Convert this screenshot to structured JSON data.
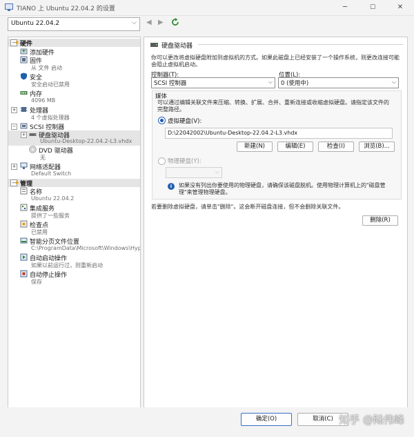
{
  "window": {
    "title": "TIANO 上 Ubuntu 22.04.2 的设置",
    "minimize": "─",
    "maximize": "☐",
    "close": "✕"
  },
  "toolbar": {
    "vm_selected": "Ubuntu 22.04.2",
    "back_icon": "◀",
    "forward_icon": "▶"
  },
  "sections": {
    "hardware": "硬件",
    "management": "管理"
  },
  "hardware_items": {
    "add_hardware": "添加硬件",
    "firmware": "固件",
    "firmware_sub": "从 文件 启动",
    "security": "安全",
    "security_sub": "安全启动已禁用",
    "memory": "内存",
    "memory_sub": "4096 MB",
    "processor": "处理器",
    "processor_sub": "4 个虚拟处理器",
    "scsi": "SCSI 控制器",
    "hard_drive": "硬盘驱动器",
    "hard_drive_sub": "Ubuntu-Desktop-22.04.2-L3.vhdx",
    "dvd": "DVD 驱动器",
    "dvd_sub": "无",
    "network": "网络适配器",
    "network_sub": "Default Switch"
  },
  "management_items": {
    "name": "名称",
    "name_sub": "Ubuntu 22.04.2",
    "integration": "集成服务",
    "integration_sub": "提供了一些服务",
    "checkpoints": "检查点",
    "checkpoints_sub": "已禁用",
    "paging": "智能分页文件位置",
    "paging_sub": "C:\\ProgramData\\Microsoft\\Windows\\Hyper-V",
    "auto_start": "自动启动操作",
    "auto_start_sub": "如果以前运行过，则重新启动",
    "auto_stop": "自动停止操作",
    "auto_stop_sub": "保存"
  },
  "details": {
    "header": "硬盘驱动器",
    "intro": "你可以更改将虚拟硬盘附加到虚拟机的方式。如果此磁盘上已经安装了一个操作系统，则更改连接可能会阻止虚拟机启动。",
    "controller_label": "控制器(T):",
    "controller_value": "SCSI 控制器",
    "location_label": "位置(L):",
    "location_value": "0 (使用中)",
    "media_label": "媒体",
    "media_desc": "可以通过编辑关联文件来压缩、转换、扩展、合并、重新连接或收缩虚拟硬盘。请指定该文件的完整路径。",
    "vhd_label": "虚拟硬盘(V):",
    "vhd_path": "D:\\22042002\\Ubuntu-Desktop-22.04.2-L3.vhdx",
    "btn_new": "新建(N)",
    "btn_edit": "编辑(E)",
    "btn_inspect": "检查(I)",
    "btn_browse": "浏览(B)...",
    "physical_label": "物理硬盘(Y):",
    "physical_info": "如果没有列出你要使用的物理硬盘，请确保该磁盘脱机。使用物理计算机上的\"磁盘管理\"来管理物理硬盘。",
    "remove_note": "若要删除虚拟硬盘，请单击\"删除\"。这会断开磁盘连接，但不会删除关联文件。",
    "btn_remove": "删除(R)"
  },
  "footer": {
    "ok": "确定(O)",
    "cancel": "取消(C)",
    "watermark": "知乎 @陆伟峰"
  },
  "colors": {
    "accent": "#1d58b8",
    "shield": "#1f5fb0",
    "refresh": "#2e8b2e"
  }
}
